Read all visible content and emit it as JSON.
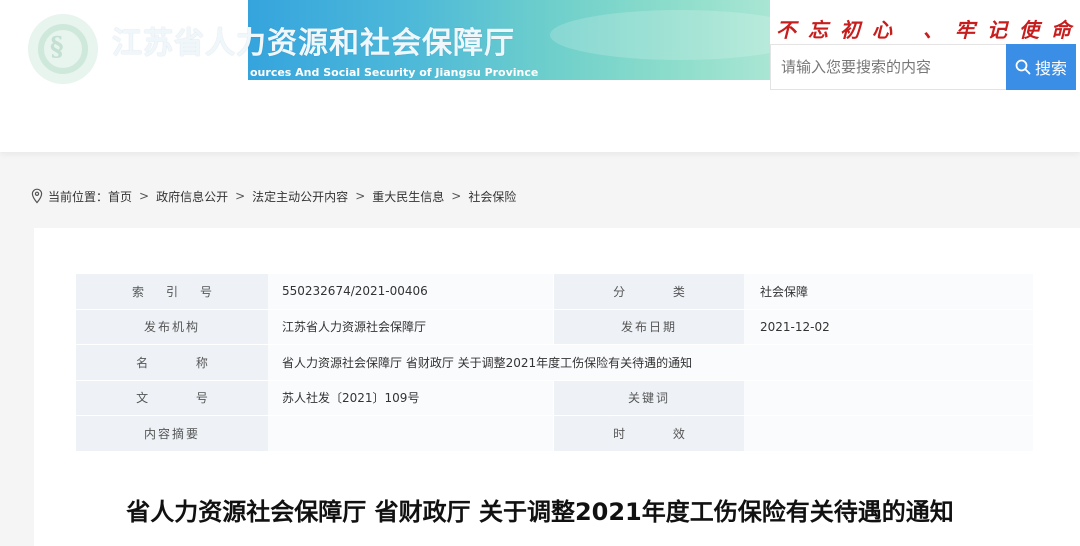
{
  "header": {
    "site_title": "江苏省人力资源和社会保障厅",
    "site_subtitle": "ources And Social Security of Jiangsu Province",
    "slogan": "不忘初心 、牢记使命",
    "search_placeholder": "请输入您要搜索的内容",
    "search_button_label": "搜索",
    "logo_icon": "logo-emblem-icon",
    "colors": {
      "banner_start": "#35a4dd",
      "banner_end": "#a9e6d3",
      "search_button": "#3a8ee6",
      "slogan": "#c81d1d"
    }
  },
  "breadcrumb": {
    "prefix": "当前位置：",
    "items": [
      "首页",
      "政府信息公开",
      "法定主动公开内容",
      "重大民生信息",
      "社会保险"
    ],
    "separator": ">",
    "icon": "location-pin-icon"
  },
  "meta": {
    "index_label": "索引号",
    "index_value": "550232674/2021-00406",
    "category_label": "分 类",
    "category_value": "社会保障",
    "publisher_label": "发布机构",
    "publisher_value": "江苏省人力资源社会保障厅",
    "date_label": "发布日期",
    "date_value": "2021-12-02",
    "name_label": "名 称",
    "name_value": "省人力资源社会保障厅 省财政厅 关于调整2021年度工伤保险有关待遇的通知",
    "docno_label": "文 号",
    "docno_value": "苏人社发〔2021〕109号",
    "keywords_label": "关键词",
    "keywords_value": "",
    "summary_label": "内容摘要",
    "summary_value": "",
    "validity_label": "时 效",
    "validity_value": ""
  },
  "document": {
    "title": "省人力资源社会保障厅 省财政厅 关于调整2021年度工伤保险有关待遇的通知"
  }
}
